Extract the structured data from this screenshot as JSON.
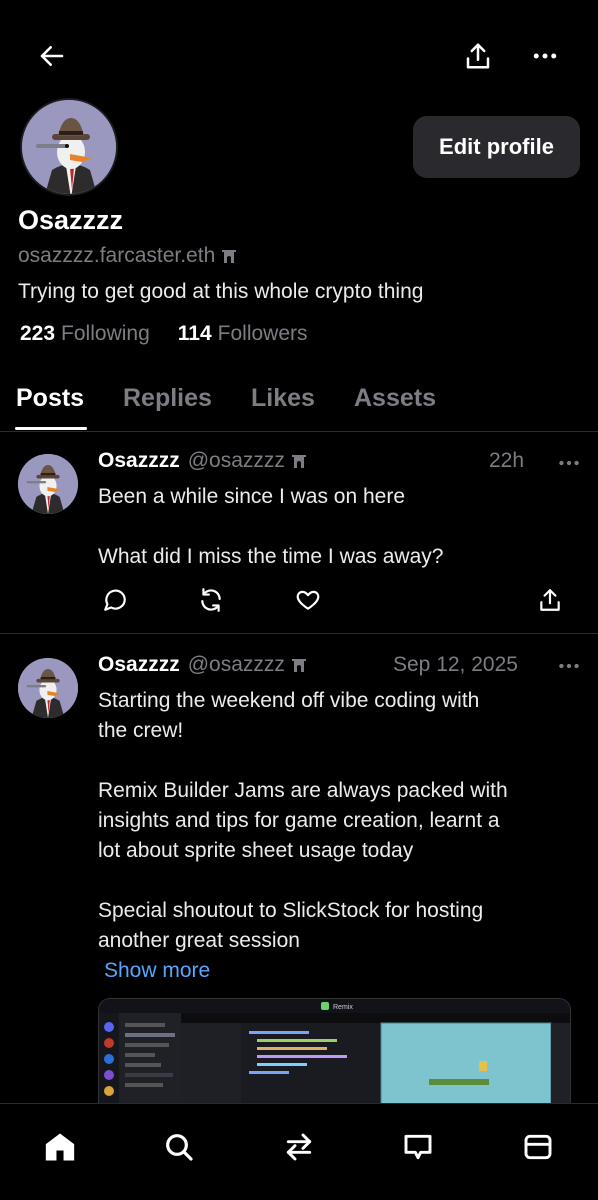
{
  "topbar": {
    "back_icon": "arrow-left-icon",
    "share_icon": "share-upload-icon",
    "more_icon": "more-horizontal-icon"
  },
  "profile": {
    "display_name": "Osazzzz",
    "username": "osazzzz.farcaster.eth",
    "bio": "Trying to get good at this whole crypto thing",
    "following_count": "223",
    "following_label": "Following",
    "followers_count": "114",
    "followers_label": "Followers",
    "edit_label": "Edit profile"
  },
  "tabs": [
    {
      "label": "Posts",
      "active": true
    },
    {
      "label": "Replies",
      "active": false
    },
    {
      "label": "Likes",
      "active": false
    },
    {
      "label": "Assets",
      "active": false
    }
  ],
  "posts": [
    {
      "author": "Osazzzz",
      "handle": "@osazzzz",
      "time": "22h",
      "lines": [
        "Been a while since I was on here",
        "",
        "What did I miss the time I was away?"
      ]
    },
    {
      "author": "Osazzzz",
      "handle": "@osazzzz",
      "time": "Sep 12, 2025",
      "lines": [
        "Starting the weekend off vibe coding with",
        "the crew!",
        "",
        "Remix Builder Jams are always packed with",
        "insights and tips for game creation, learnt a",
        "lot about sprite sheet usage today",
        "",
        "Special shoutout to SlickStock for hosting",
        "another great session"
      ],
      "show_more": "Show more",
      "media_title": "Remix"
    }
  ],
  "bottom_nav": [
    "home-icon",
    "search-icon",
    "repost-swap-icon",
    "messages-icon",
    "apps-icon"
  ],
  "colors": {
    "background": "#000000",
    "muted": "#7d7d84",
    "link": "#58a6ff",
    "button_bg": "#2a2a2e"
  }
}
